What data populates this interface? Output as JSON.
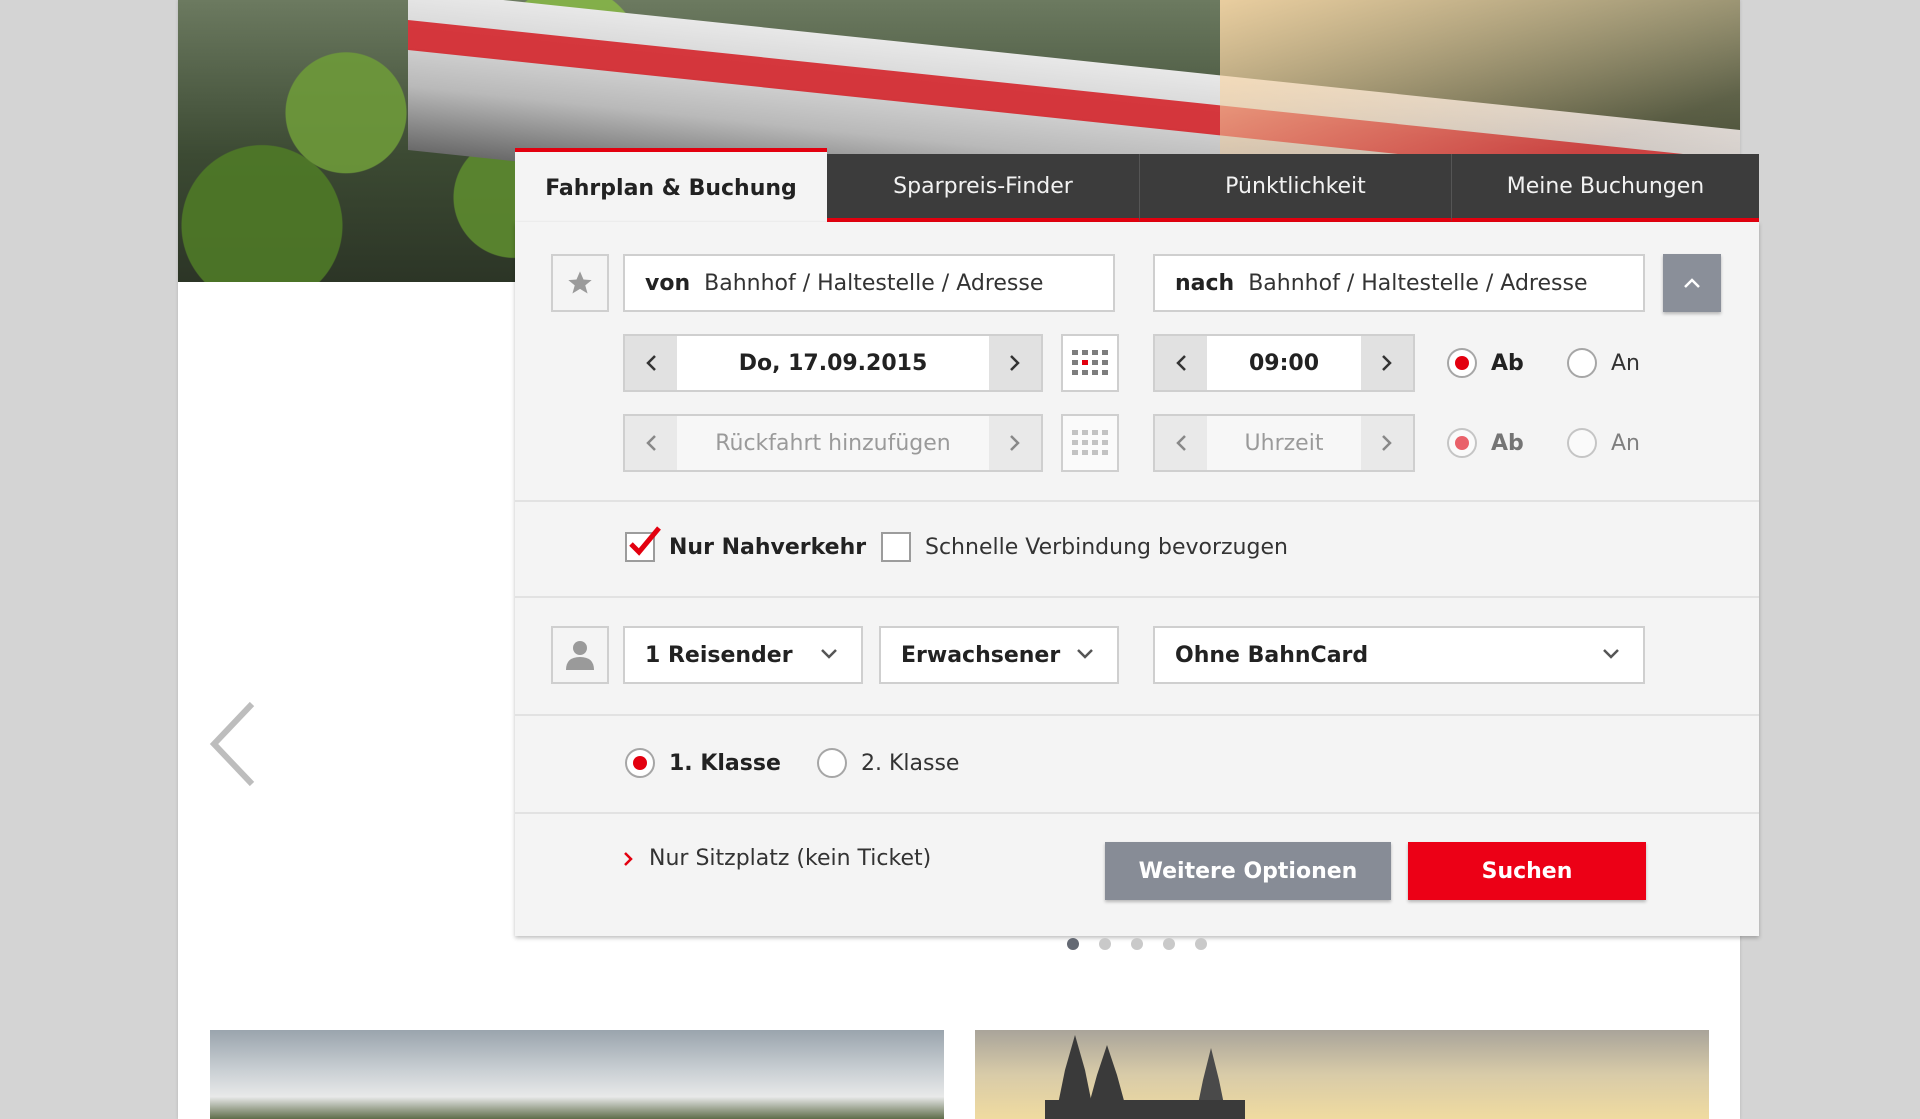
{
  "tabs": [
    {
      "label": "Fahrplan & Buchung",
      "active": true
    },
    {
      "label": "Sparpreis-Finder",
      "active": false
    },
    {
      "label": "Pünktlichkeit",
      "active": false
    },
    {
      "label": "Meine Buchungen",
      "active": false
    }
  ],
  "route": {
    "from_prefix": "von",
    "from_placeholder": "Bahnhof / Haltestelle / Adresse",
    "to_prefix": "nach",
    "to_placeholder": "Bahnhof / Haltestelle / Adresse"
  },
  "outbound": {
    "date": "Do, 17.09.2015",
    "time": "09:00",
    "mode_departure": "Ab",
    "mode_arrival": "An",
    "selected": "Ab"
  },
  "return": {
    "date_placeholder": "Rückfahrt hinzufügen",
    "time_placeholder": "Uhrzeit",
    "mode_departure": "Ab",
    "mode_arrival": "An",
    "selected": "Ab"
  },
  "options": {
    "local_only_label": "Nur Nahverkehr",
    "local_only_checked": true,
    "fast_label": "Schnelle Verbindung bevorzugen",
    "fast_checked": false
  },
  "passengers": {
    "count": "1 Reisender",
    "type": "Erwachsener",
    "bahncard": "Ohne BahnCard"
  },
  "class": {
    "first_label": "1. Klasse",
    "second_label": "2. Klasse",
    "selected": "1"
  },
  "footer": {
    "seat_only_link": "Nur Sitzplatz (kein Ticket)",
    "more_options_button": "Weitere Optionen",
    "search_button": "Suchen"
  },
  "carousel": {
    "dots": 5,
    "current": 1
  },
  "colors": {
    "accent": "#e3000f",
    "dark_tab": "#3c3c3c",
    "grey_button": "#878c96",
    "panel": "#f4f4f4"
  }
}
